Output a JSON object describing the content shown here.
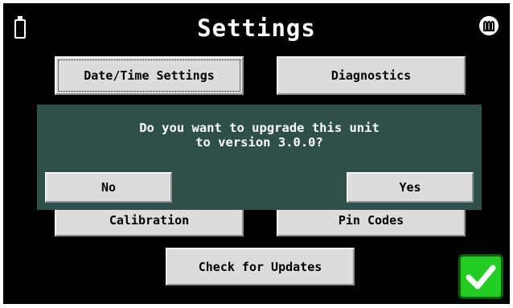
{
  "header": {
    "title": "Settings",
    "battery_icon": "battery-icon",
    "heat_icon": "heat-element-icon"
  },
  "menu": {
    "date_time_label": "Date/Time Settings",
    "diagnostics_label": "Diagnostics",
    "calibration_label": "Calibration",
    "pin_codes_label": "Pin Codes",
    "check_updates_label": "Check for Updates"
  },
  "dialog": {
    "message_line1": "Do you want to upgrade this unit",
    "message_line2": "to version 3.0.0?",
    "no_label": "No",
    "yes_label": "Yes",
    "background_color": "#2f4f4b"
  },
  "confirm": {
    "icon": "checkmark-icon",
    "color": "#22cc22"
  }
}
